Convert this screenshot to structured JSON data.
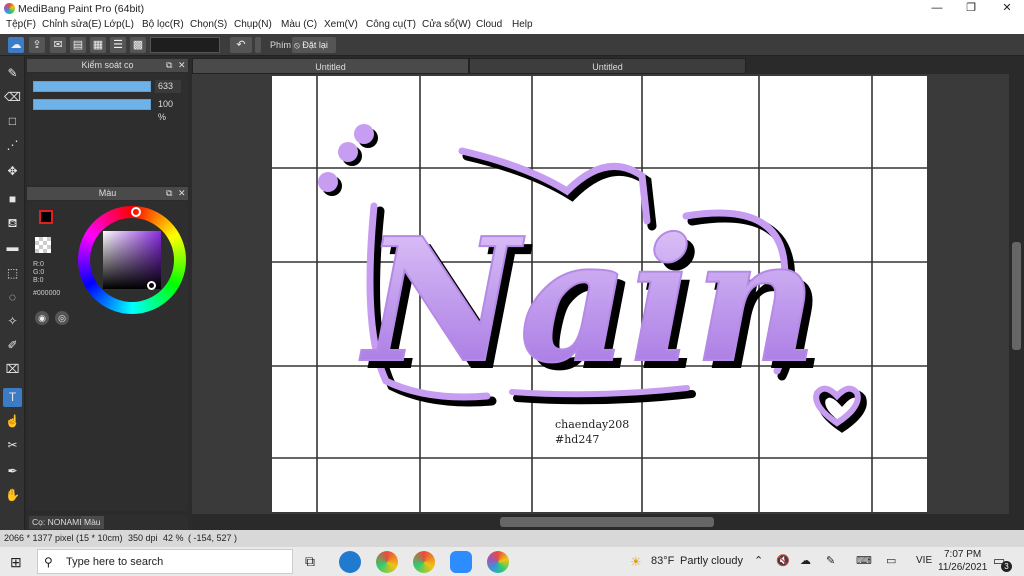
{
  "window": {
    "title": "MediBang Paint Pro (64bit)",
    "minimize": "—",
    "maximize": "❐",
    "close": "✕"
  },
  "menu": [
    "Tệp(F)",
    "Chỉnh sửa(E)",
    "Lớp(L)",
    "Bộ lọc(R)",
    "Chọn(S)",
    "Chụp(N)",
    "Màu (C)",
    "Xem(V)",
    "Công cụ(T)",
    "Cửa sổ(W)",
    "Cloud",
    "Help"
  ],
  "toolbar": {
    "key_label": "Phím",
    "reset_label": "Đặt lại",
    "undo_icon": "undo-icon"
  },
  "brush_panel": {
    "title": "Kiểm soát cọ",
    "size_value": "633",
    "opacity_value": "100 %"
  },
  "color_panel": {
    "title": "Màu",
    "r": "R:0",
    "g": "G:0",
    "b": "B:0",
    "hex": "#000000",
    "fg_color": "#000000",
    "accent": "#e02020"
  },
  "panel_tabs": {
    "brush_tab": "Cọ: NONAME",
    "color_tab": "Màu"
  },
  "doc_tabs": [
    "Untitled",
    "Untitled"
  ],
  "artwork": {
    "word": "Nain",
    "signature_line1": "chaenday208",
    "signature_line2": "#hd247",
    "fill": "#c79df2",
    "grid": true
  },
  "status": {
    "size": "2066 * 1377 pixel",
    "physical": "(15 * 10cm)",
    "dpi": "350 dpi",
    "zoom": "42 %",
    "cursor": "( -154, 527 )"
  },
  "taskbar": {
    "search_placeholder": "Type here to search",
    "weather_temp": "83°F",
    "weather_text": "Partly cloudy",
    "lang": "VIE",
    "time": "7:07 PM",
    "date": "11/26/2021",
    "notif_count": "3"
  }
}
